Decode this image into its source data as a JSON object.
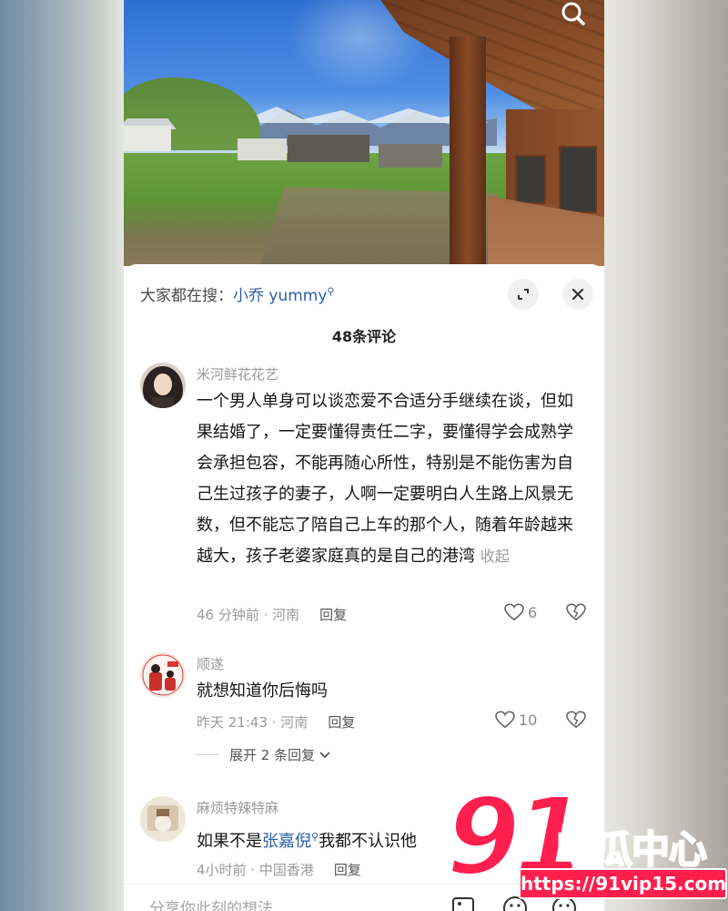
{
  "video": {
    "search_icon": "search-icon"
  },
  "panel": {
    "search_hint_prefix": "大家都在搜：",
    "search_hint_keyword": "小乔 yummy",
    "comment_count": "48条评论"
  },
  "comments": [
    {
      "author": "米河鲜花花艺",
      "text": "一个男人单身可以谈恋爱不合适分手继续在谈，但如果结婚了，一定要懂得责任二字，要懂得学会成熟学会承担包容，不能再随心所性，特别是不能伤害为自己生过孩子的妻子，人啊一定要明白人生路上风景无数，但不能忘了陪自己上车的那个人，随着年龄越来越大，孩子老婆家庭真的是自己的港湾",
      "collapse_label": "收起",
      "time_location": "46 分钟前 · 河南",
      "reply_label": "回复",
      "likes": "6"
    },
    {
      "author": "顺遂",
      "text": "就想知道你后悔吗",
      "time_location": "昨天 21:43 · 河南",
      "reply_label": "回复",
      "likes": "10",
      "expand_label": "展开 2 条回复"
    },
    {
      "author": "麻烦特辣特麻",
      "text_prefix": "如果不是",
      "mention": "张嘉倪",
      "text_suffix": "我都不认识他",
      "time_location": "4小时前 · 中国香港",
      "reply_label": "回复"
    }
  ],
  "input": {
    "placeholder": "分享你此刻的想法",
    "icons": [
      "image-icon",
      "emoji-icon",
      "emoji-icon"
    ]
  },
  "watermark": {
    "logo_number": "91",
    "logo_text": "吃瓜中心",
    "url": "https://91vip15.com"
  },
  "colors": {
    "mention": "#2a5ea8",
    "watermark": "#ff1f4f"
  }
}
